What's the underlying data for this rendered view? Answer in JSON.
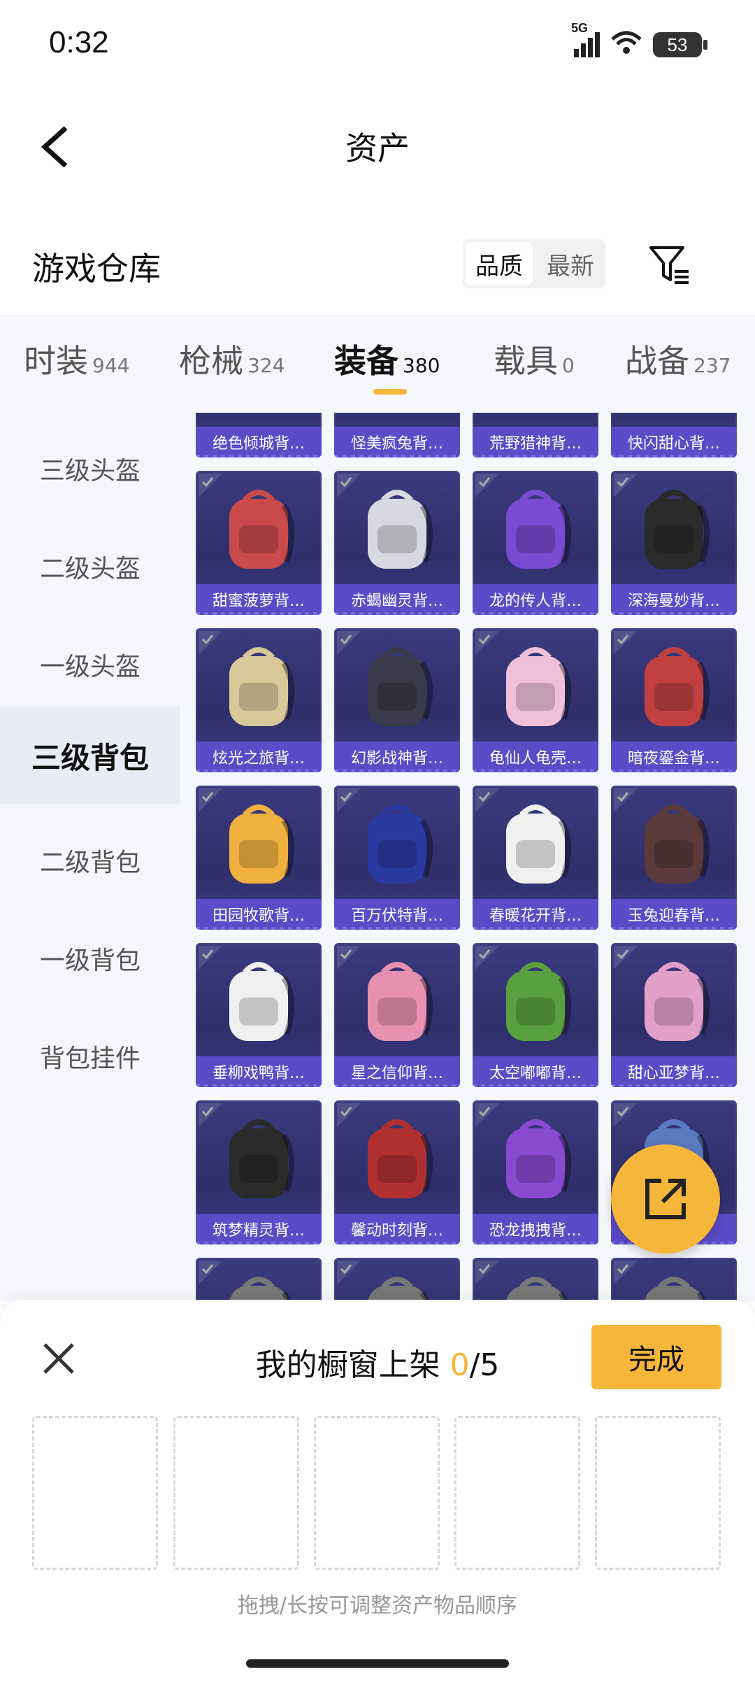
{
  "status_bar": {
    "time": "0:32",
    "network": "5G",
    "battery": "53"
  },
  "header": {
    "title": "资产"
  },
  "warehouse": {
    "title": "游戏仓库",
    "sort_quality": "品质",
    "sort_latest": "最新"
  },
  "tabs": [
    {
      "label": "时装",
      "count": "944"
    },
    {
      "label": "枪械",
      "count": "324"
    },
    {
      "label": "装备",
      "count": "380"
    },
    {
      "label": "载具",
      "count": "0"
    },
    {
      "label": "战备",
      "count": "237"
    }
  ],
  "sidebar": {
    "items": [
      {
        "label": "三级头盔"
      },
      {
        "label": "二级头盔"
      },
      {
        "label": "一级头盔"
      },
      {
        "label": "三级背包"
      },
      {
        "label": "二级背包"
      },
      {
        "label": "一级背包"
      },
      {
        "label": "背包挂件"
      }
    ]
  },
  "items": [
    {
      "name": "绝色倾城背…"
    },
    {
      "name": "怪美疯兔背…"
    },
    {
      "name": "荒野猎神背…"
    },
    {
      "name": "快闪甜心背…"
    },
    {
      "name": "甜蜜菠萝背…"
    },
    {
      "name": "赤蝎幽灵背…"
    },
    {
      "name": "龙的传人背…"
    },
    {
      "name": "深海曼妙背…"
    },
    {
      "name": "炫光之旅背…"
    },
    {
      "name": "幻影战神背…"
    },
    {
      "name": "龟仙人龟壳…"
    },
    {
      "name": "暗夜鎏金背…"
    },
    {
      "name": "田园牧歌背…"
    },
    {
      "name": "百万伏特背…"
    },
    {
      "name": "春暖花开背…"
    },
    {
      "name": "玉兔迎春背…"
    },
    {
      "name": "垂柳戏鸭背…"
    },
    {
      "name": "星之信仰背…"
    },
    {
      "name": "太空嘟嘟背…"
    },
    {
      "name": "甜心亚梦背…"
    },
    {
      "name": "筑梦精灵背…"
    },
    {
      "name": "馨动时刻背…"
    },
    {
      "name": "恐龙拽拽背…"
    },
    {
      "name": ""
    },
    {
      "name": ""
    },
    {
      "name": ""
    },
    {
      "name": ""
    },
    {
      "name": ""
    }
  ],
  "showcase": {
    "title": "我的橱窗上架",
    "current": "0",
    "max": "/5",
    "done_label": "完成",
    "hint": "拖拽/长按可调整资产物品顺序"
  },
  "colors": {
    "accent": "#f5b63a",
    "card_bg": "#34347a",
    "card_label": "#5b4bc7"
  }
}
